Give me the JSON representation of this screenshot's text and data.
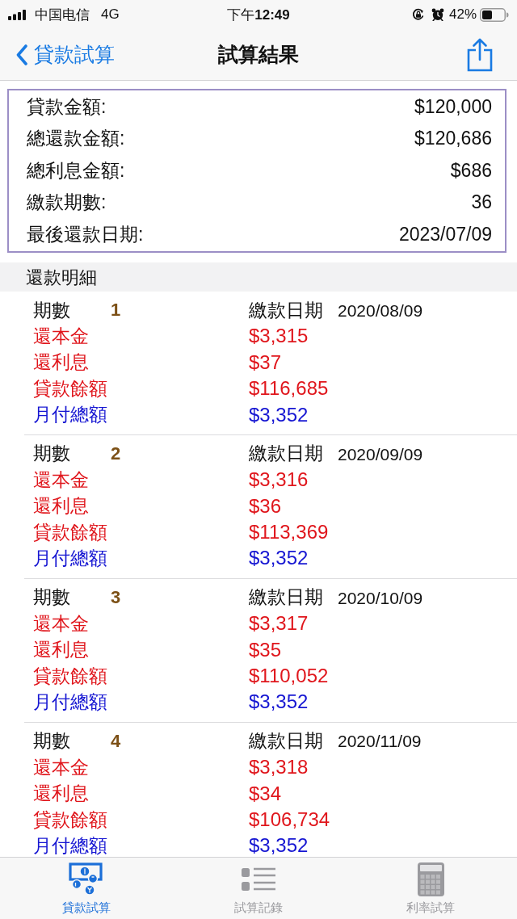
{
  "status_bar": {
    "carrier": "中国电信",
    "network": "4G",
    "time": "下午**12:49**",
    "battery": "42%"
  },
  "nav_bar": {
    "back": "貸款試算",
    "title": "試算結果"
  },
  "summary": [
    {
      "label": "貸款金額:",
      "value": "$120,000"
    },
    {
      "label": "總還款金額:",
      "value": "$120,686"
    },
    {
      "label": "總利息金額:",
      "value": "$686"
    },
    {
      "label": "繳款期數:",
      "value": "36"
    },
    {
      "label": "最後還款日期:",
      "value": "2023/07/09"
    }
  ],
  "detail_header": "還款明細",
  "payments": [
    {
      "period_label": "期數",
      "period": "1",
      "date_label": "繳款日期",
      "date": "2020/08/09",
      "lines": [
        {
          "label": "還本金",
          "value": "$3,315",
          "color": "#e0161c"
        },
        {
          "label": "還利息",
          "value": "$37",
          "color": "#e0161c"
        },
        {
          "label": "貸款餘額",
          "value": "$116,685",
          "color": "#e0161c"
        },
        {
          "label": "月付總額",
          "value": "$3,352",
          "color": "#1616d2"
        }
      ]
    },
    {
      "period_label": "期數",
      "period": "2",
      "date_label": "繳款日期",
      "date": "2020/09/09",
      "lines": [
        {
          "label": "還本金",
          "value": "$3,316",
          "color": "#e0161c"
        },
        {
          "label": "還利息",
          "value": "$36",
          "color": "#e0161c"
        },
        {
          "label": "貸款餘額",
          "value": "$113,369",
          "color": "#e0161c"
        },
        {
          "label": "月付總額",
          "value": "$3,352",
          "color": "#1616d2"
        }
      ]
    },
    {
      "period_label": "期數",
      "period": "3",
      "date_label": "繳款日期",
      "date": "2020/10/09",
      "lines": [
        {
          "label": "還本金",
          "value": "$3,317",
          "color": "#e0161c"
        },
        {
          "label": "還利息",
          "value": "$35",
          "color": "#e0161c"
        },
        {
          "label": "貸款餘額",
          "value": "$110,052",
          "color": "#e0161c"
        },
        {
          "label": "月付總額",
          "value": "$3,352",
          "color": "#1616d2"
        }
      ]
    },
    {
      "period_label": "期數",
      "period": "4",
      "date_label": "繳款日期",
      "date": "2020/11/09",
      "lines": [
        {
          "label": "還本金",
          "value": "$3,318",
          "color": "#e0161c"
        },
        {
          "label": "還利息",
          "value": "$34",
          "color": "#e0161c"
        },
        {
          "label": "貸款餘額",
          "value": "$106,734",
          "color": "#e0161c"
        },
        {
          "label": "月付總額",
          "value": "$3,352",
          "color": "#1616d2"
        }
      ]
    }
  ],
  "tabs": [
    {
      "label": "貸款試算",
      "selected": true
    },
    {
      "label": "試算記錄",
      "selected": false
    },
    {
      "label": "利率試算",
      "selected": false
    }
  ]
}
